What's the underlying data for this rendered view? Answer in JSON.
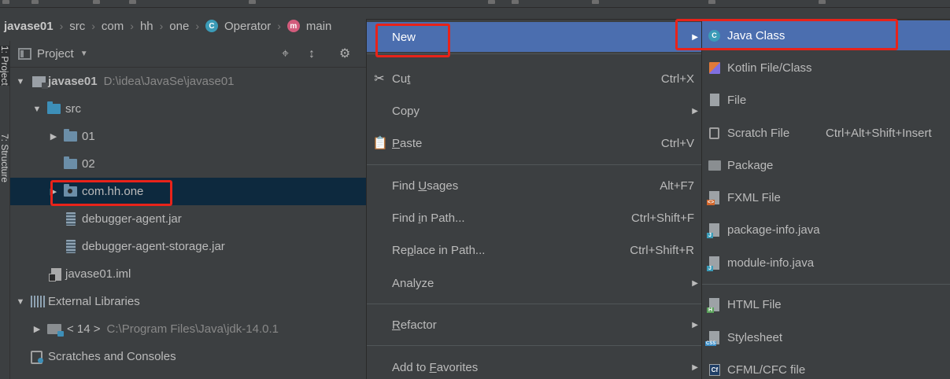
{
  "breadcrumb": {
    "items": [
      "javase01",
      "src",
      "com",
      "hh",
      "one",
      "Operator",
      "main"
    ],
    "class_icon_letter": "C",
    "method_icon_letter": "m"
  },
  "tool_strip": {
    "project_label": "1: Project",
    "structure_label": "7: Structure"
  },
  "project_panel": {
    "title": "Project",
    "tree": [
      {
        "label": "javase01",
        "path": "D:\\idea\\JavaSe\\javase01",
        "expanded": true,
        "icon": "project-icon"
      },
      {
        "label": "src",
        "expanded": true,
        "icon": "source-folder-icon"
      },
      {
        "label": "01",
        "expanded": false,
        "icon": "folder-icon"
      },
      {
        "label": "02",
        "icon": "folder-icon"
      },
      {
        "label": "com.hh.one",
        "expanded": false,
        "selected": true,
        "icon": "package-icon"
      },
      {
        "label": "debugger-agent.jar",
        "icon": "jar-icon"
      },
      {
        "label": "debugger-agent-storage.jar",
        "icon": "jar-icon"
      },
      {
        "label": "javase01.iml",
        "icon": "iml-file-icon"
      },
      {
        "label": "External Libraries",
        "expanded": true,
        "icon": "libraries-icon"
      },
      {
        "label": "< 14 >",
        "path": "C:\\Program Files\\Java\\jdk-14.0.1",
        "expanded": false,
        "icon": "jdk-icon"
      },
      {
        "label": "Scratches and Consoles",
        "icon": "scratches-icon"
      }
    ]
  },
  "context_menu": {
    "items": [
      {
        "label": "New",
        "has_submenu": true,
        "active": true
      },
      {
        "label": "Cut",
        "mnemonic_index": 2,
        "shortcut": "Ctrl+X",
        "icon": "scissors-icon"
      },
      {
        "label": "Copy",
        "has_submenu": true
      },
      {
        "label": "Paste",
        "mnemonic_index": 0,
        "shortcut": "Ctrl+V",
        "icon": "clipboard-icon"
      },
      {
        "label": "Find Usages",
        "mnemonic_index": 5,
        "shortcut": "Alt+F7"
      },
      {
        "label": "Find in Path...",
        "mnemonic_index": 5,
        "shortcut": "Ctrl+Shift+F"
      },
      {
        "label": "Replace in Path...",
        "mnemonic_index": 2,
        "shortcut": "Ctrl+Shift+R"
      },
      {
        "label": "Analyze",
        "has_submenu": true
      },
      {
        "label": "Refactor",
        "mnemonic_index": 0,
        "has_submenu": true
      },
      {
        "label": "Add to Favorites",
        "mnemonic_index": 7,
        "has_submenu": true
      }
    ]
  },
  "new_submenu": {
    "items": [
      {
        "label": "Java Class",
        "active": true,
        "icon": "java-class-icon",
        "icon_letter": "C"
      },
      {
        "label": "Kotlin File/Class",
        "icon": "kotlin-icon"
      },
      {
        "label": "File",
        "icon": "file-icon"
      },
      {
        "label": "Scratch File",
        "shortcut": "Ctrl+Alt+Shift+Insert",
        "icon": "scratch-file-icon"
      },
      {
        "label": "Package",
        "icon": "package-icon"
      },
      {
        "label": "FXML File",
        "icon": "fxml-icon"
      },
      {
        "label": "package-info.java",
        "icon": "java-file-icon"
      },
      {
        "label": "module-info.java",
        "icon": "java-file-icon"
      },
      {
        "label": "HTML File",
        "icon": "html-file-icon"
      },
      {
        "label": "Stylesheet",
        "icon": "css-file-icon"
      },
      {
        "label": "CFML/CFC file",
        "icon": "cfml-icon",
        "icon_letter": "Cf"
      }
    ]
  },
  "colors": {
    "background": "#3c3f41",
    "menu_highlight": "#4b6eaf",
    "tree_selection": "#0d293e",
    "annotation_red": "#e8231a"
  }
}
